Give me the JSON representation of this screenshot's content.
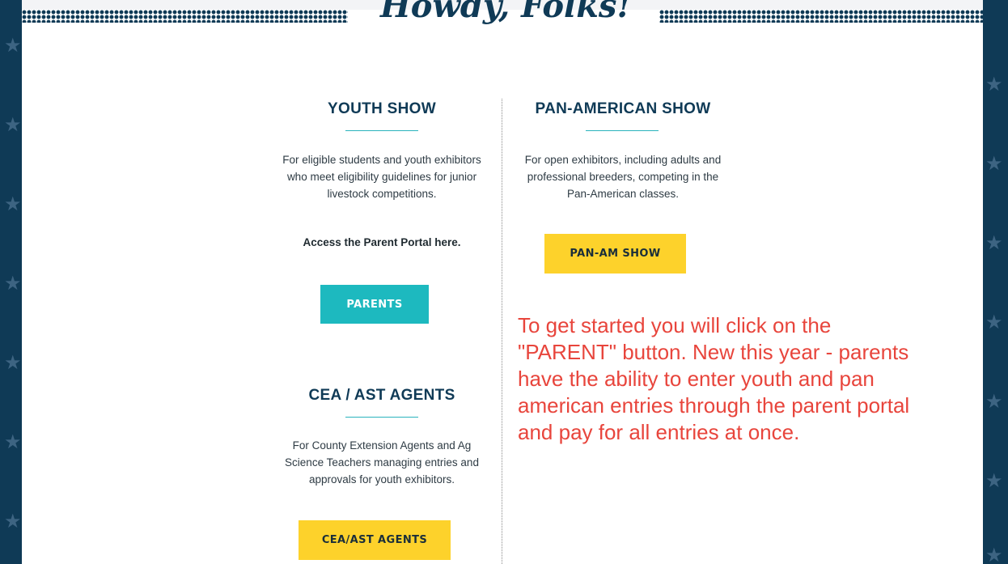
{
  "colors": {
    "navy": "#0f3a56",
    "teal": "#1db9bf",
    "yellow": "#fdd22b",
    "note_red": "#e8453c"
  },
  "banner": {
    "title": "Howdy, Folks!"
  },
  "youth": {
    "title": "YOUTH SHOW",
    "desc_lines": [
      "For eligible students and youth exhibitors",
      "who meet eligibility guidelines for junior",
      "livestock competitions."
    ],
    "access_text": "Access the Parent Portal here.",
    "button": "PARENTS"
  },
  "panam": {
    "title": "PAN-AMERICAN SHOW",
    "desc_lines": [
      "For open exhibitors, including adults and",
      "professional breeders, competing in the",
      "Pan-American classes."
    ],
    "button": "PAN-AM SHOW"
  },
  "agents": {
    "title": "CEA / AST AGENTS",
    "desc_lines": [
      "For County Extension Agents and Ag",
      "Science Teachers managing entries and",
      "approvals for youth exhibitors."
    ],
    "button": "CEA/AST AGENTS"
  },
  "annotation": {
    "lines": [
      "To get started you will click on the",
      "\"PARENT\" button. New this year - parents",
      "have the ability to enter youth and pan",
      "american entries through the parent portal",
      "and pay for all entries at once."
    ]
  },
  "icons": {
    "border_star": "star-icon"
  }
}
